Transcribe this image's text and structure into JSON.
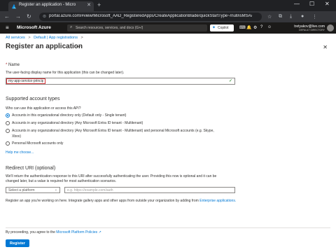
{
  "browser": {
    "tab_title": "Register an application - Micro",
    "tab_close": "✕",
    "new_tab": "+",
    "win_min": "—",
    "win_max": "☐",
    "win_close": "✕",
    "url": "portal.azure.com/#view/Microsoft_AAD_RegisteredApps/CreateApplicationBlade/quickStartType~/null/isMSAApp~/false"
  },
  "azure": {
    "brand": "Microsoft Azure",
    "search_placeholder": "Search resources, services, and docs (G+/)",
    "copilot_label": "Copilot",
    "account_name": "tretyakov@live.com",
    "account_dir": "DEFAULT DIRECTORY"
  },
  "breadcrumb": {
    "items": [
      "All services",
      "Default | App registrations"
    ],
    "sep": ">"
  },
  "page": {
    "title": "Register an application",
    "more": "···",
    "close": "✕"
  },
  "name_section": {
    "label": "Name",
    "required_mark": "* ",
    "description": "The user-facing display name for this application (this can be changed later).",
    "value": "my-app-service-principal"
  },
  "account_types": {
    "title": "Supported account types",
    "question": "Who can use this application or access this API?",
    "options": [
      {
        "line1": "Accounts in this organizational directory only (Default only - Single tenant)",
        "line2": ""
      },
      {
        "line1": "Accounts in any organizational directory (Any Microsoft Entra ID tenant - Multitenant)",
        "line2": ""
      },
      {
        "line1": "Accounts in any organizational directory (Any Microsoft Entra ID tenant - Multitenant) and personal Microsoft accounts (e.g. Skype,",
        "line2": "Xbox)"
      },
      {
        "line1": "Personal Microsoft accounts only",
        "line2": ""
      }
    ],
    "selected_index": 0,
    "help_link": "Help me choose..."
  },
  "redirect": {
    "title": "Redirect URI (optional)",
    "description_line1": "We'll return the authentication response to this URI after successfully authenticating the user. Providing this now is optional and it can be",
    "description_line2": "changed later, but a value is required for most authentication scenarios.",
    "platform_placeholder": "Select a platform",
    "uri_placeholder": "e.g. https://example.com/auth"
  },
  "gallery_note": {
    "text": "Register an app you're working on here. Integrate gallery apps and other apps from outside your organization by adding from",
    "link": "Enterprise applications."
  },
  "footer": {
    "policy_text": "By proceeding, you agree to the",
    "policy_link": "Microsoft Platform Policies",
    "register_label": "Register"
  }
}
